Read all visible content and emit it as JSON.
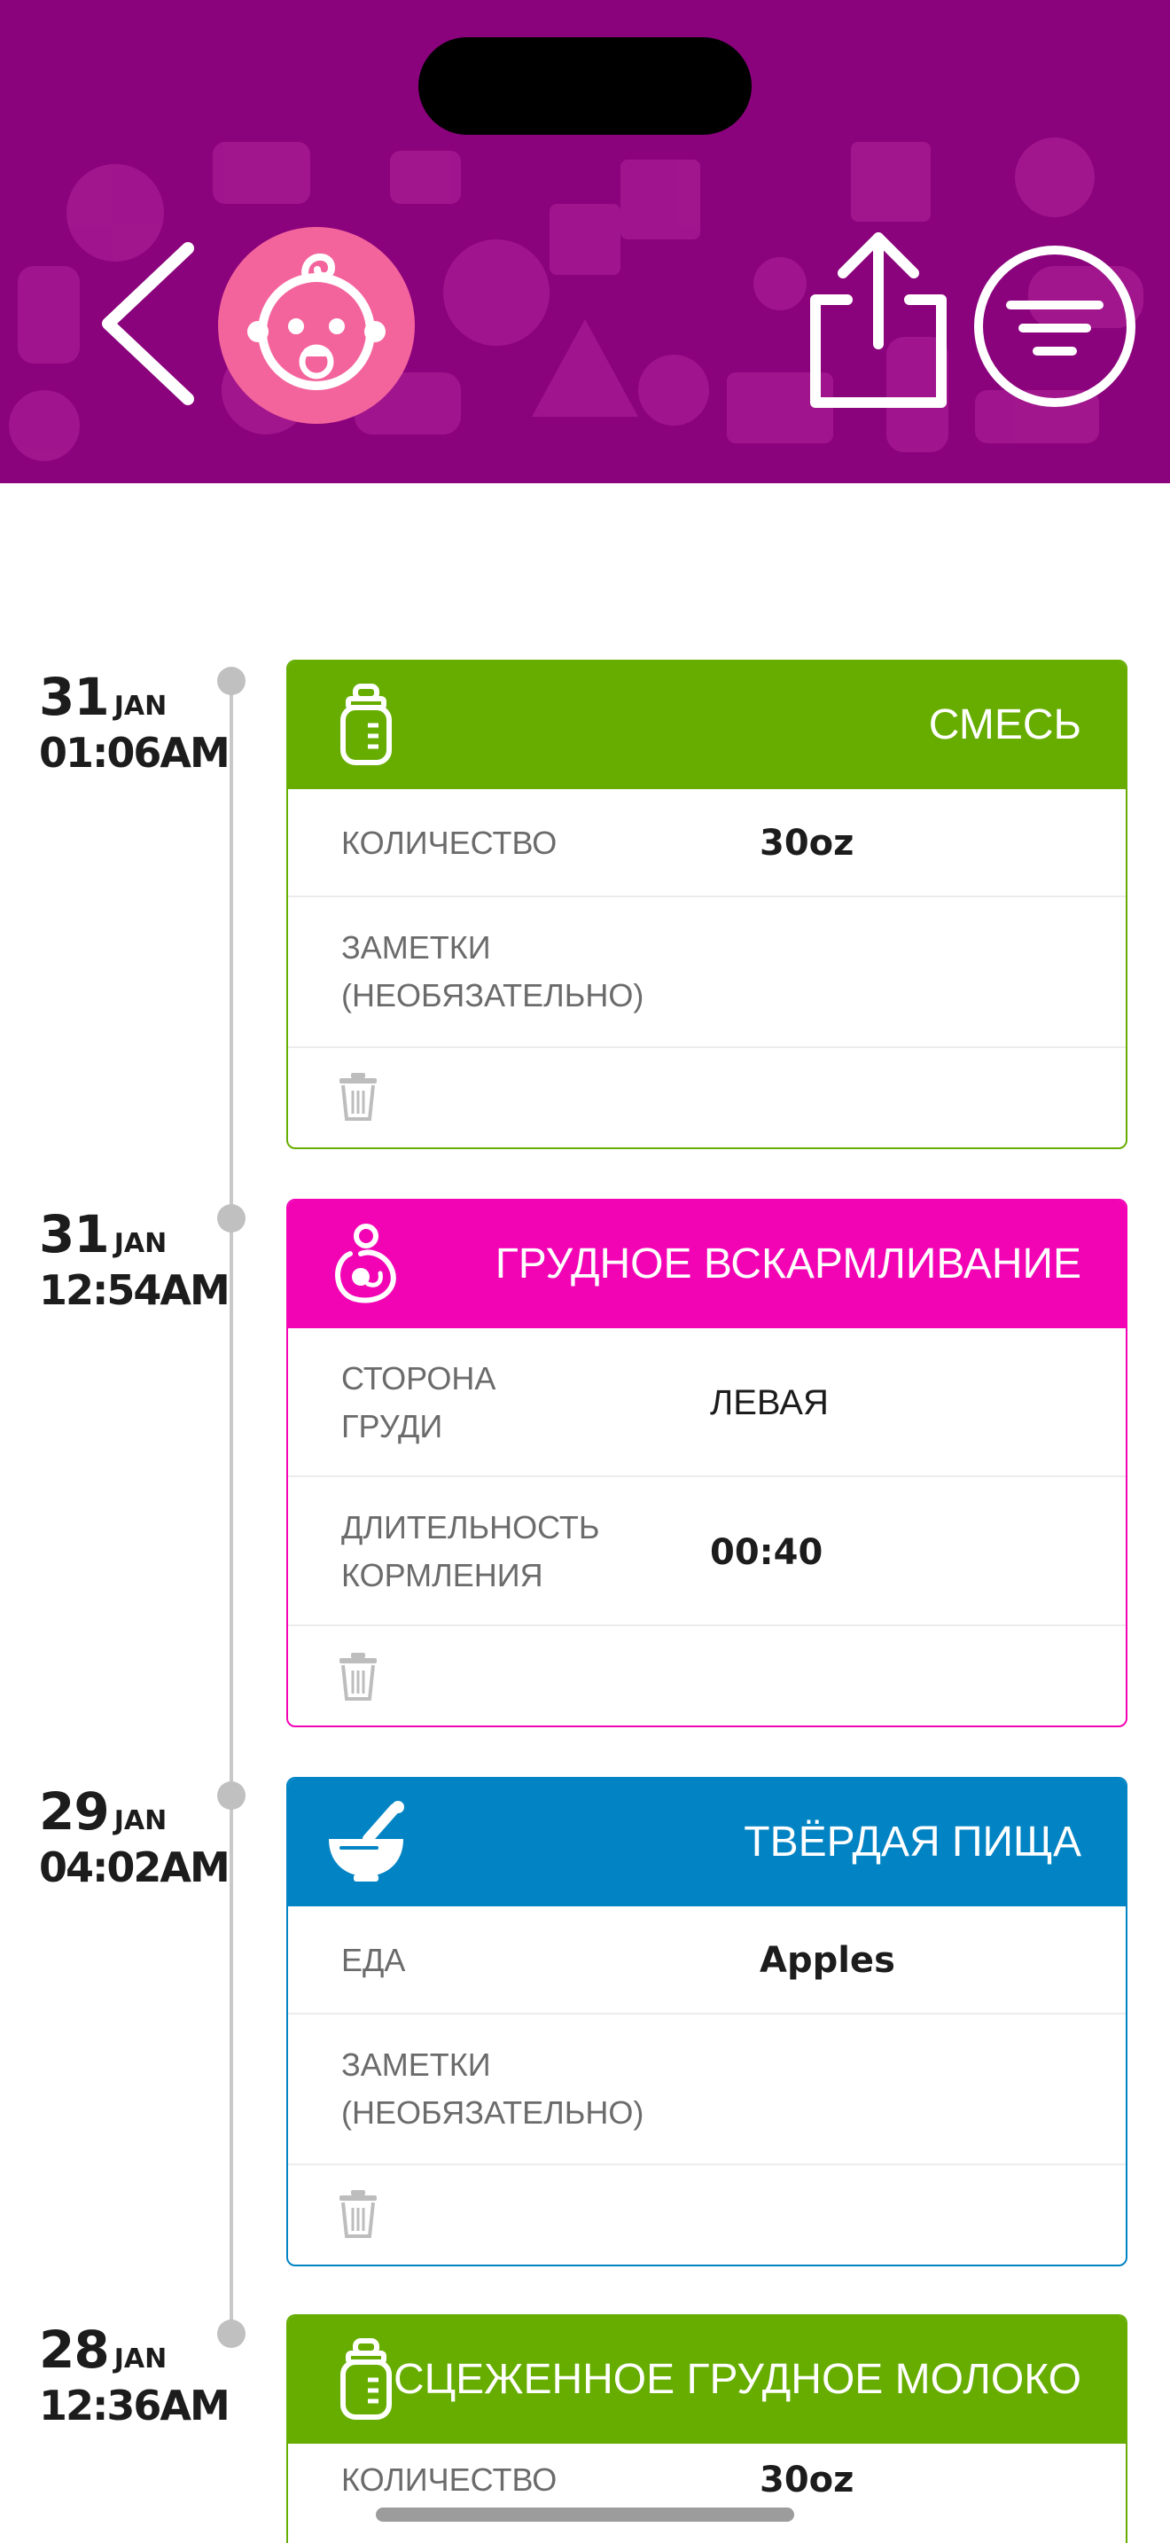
{
  "header": {
    "back_icon": "chevron-left-icon",
    "avatar_icon": "baby-face-icon",
    "share_icon": "share-icon",
    "filter_icon": "filter-icon",
    "colors": {
      "background": "#8a027c",
      "avatar": "#f4649c"
    }
  },
  "entries": [
    {
      "date": {
        "day": "31",
        "month": "JAN",
        "time": "01:06AM"
      },
      "title": "СМЕСЬ",
      "color": "#66ad00",
      "icon": "baby-bottle-icon",
      "rows": [
        {
          "label": "КОЛИЧЕСТВО",
          "value": "30oz"
        },
        {
          "label_line1": "ЗАМЕТКИ",
          "label_line2": "(НЕОБЯЗАТЕЛЬНО)",
          "value": ""
        }
      ]
    },
    {
      "date": {
        "day": "31",
        "month": "JAN",
        "time": "12:54AM"
      },
      "title": "ГРУДНОЕ ВСКАРМЛИВАНИЕ",
      "color": "#f204b5",
      "icon": "breastfeeding-icon",
      "rows": [
        {
          "label_line1": "СТОРОНА",
          "label_line2": "ГРУДИ",
          "value": "ЛЕВАЯ"
        },
        {
          "label_line1": "ДЛИТЕЛЬНОСТЬ",
          "label_line2": "КОРМЛЕНИЯ",
          "value": "00:40"
        }
      ]
    },
    {
      "date": {
        "day": "29",
        "month": "JAN",
        "time": "04:02AM"
      },
      "title": "ТВЁРДАЯ ПИЩА",
      "color": "#0284c4",
      "icon": "mortar-pestle-icon",
      "rows": [
        {
          "label": "ЕДА",
          "value": "Apples"
        },
        {
          "label_line1": "ЗАМЕТКИ",
          "label_line2": "(НЕОБЯЗАТЕЛЬНО)",
          "value": ""
        }
      ]
    },
    {
      "date": {
        "day": "28",
        "month": "JAN",
        "time": "12:36AM"
      },
      "title": "СЦЕЖЕННОЕ ГРУДНОЕ МОЛОКО",
      "color": "#66ad00",
      "icon": "baby-bottle-icon",
      "rows": [
        {
          "label": "КОЛИЧЕСТВО",
          "value": "30oz"
        }
      ]
    }
  ]
}
